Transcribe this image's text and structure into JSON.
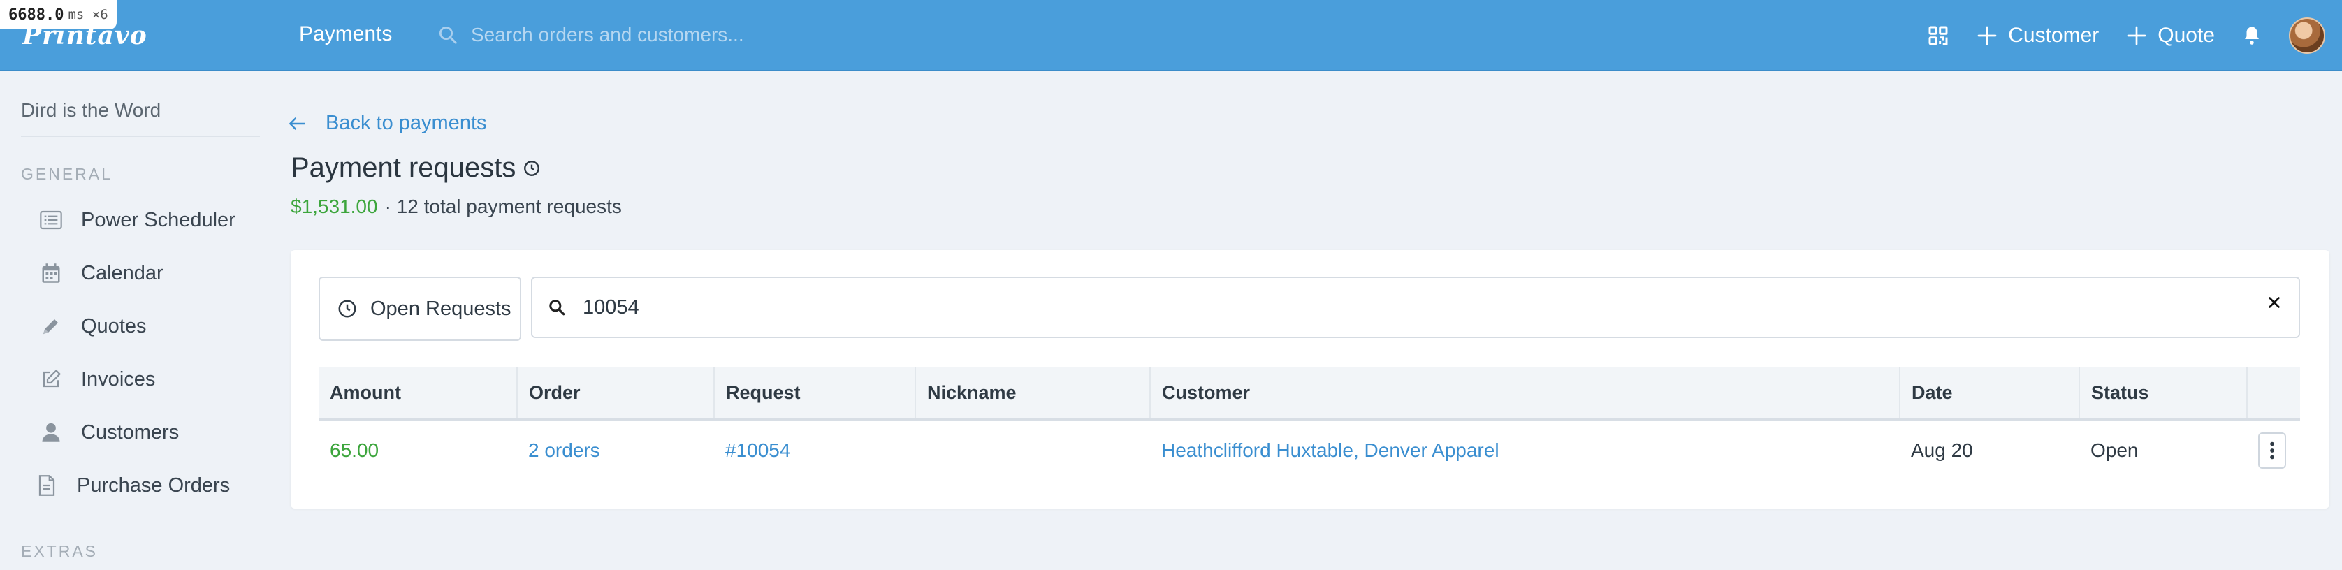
{
  "perf_badge": {
    "value": "6688.0",
    "unit": "ms ×6"
  },
  "topbar": {
    "logo": "Printavo",
    "nav_payments": "Payments",
    "search_placeholder": "Search orders and customers...",
    "customer_btn": "Customer",
    "quote_btn": "Quote",
    "accent_color": "#4a9edb"
  },
  "sidebar": {
    "org_name": "Dird is the Word",
    "general_heading": "GENERAL",
    "items": [
      {
        "label": "Power Scheduler",
        "icon": "list-icon"
      },
      {
        "label": "Calendar",
        "icon": "calendar-icon"
      },
      {
        "label": "Quotes",
        "icon": "pencil-icon"
      },
      {
        "label": "Invoices",
        "icon": "edit-icon"
      },
      {
        "label": "Customers",
        "icon": "user-icon"
      },
      {
        "label": "Purchase Orders",
        "icon": "document-icon"
      }
    ],
    "extras_heading": "EXTRAS"
  },
  "main": {
    "back_link": "Back to payments",
    "title": "Payment requests",
    "total_amount": "$1,531.00",
    "summary_text": "· 12 total payment requests",
    "filter_label": "Open Requests",
    "search_value": "10054",
    "columns": [
      "Amount",
      "Order",
      "Request",
      "Nickname",
      "Customer",
      "Date",
      "Status"
    ],
    "rows": [
      {
        "amount": "65.00",
        "order": "2 orders",
        "request": "#10054",
        "nickname": "",
        "customer": "Heathclifford Huxtable, Denver Apparel",
        "date": "Aug 20",
        "status": "Open"
      }
    ],
    "amount_color": "#3ca53c",
    "link_color": "#3a8ed0"
  }
}
